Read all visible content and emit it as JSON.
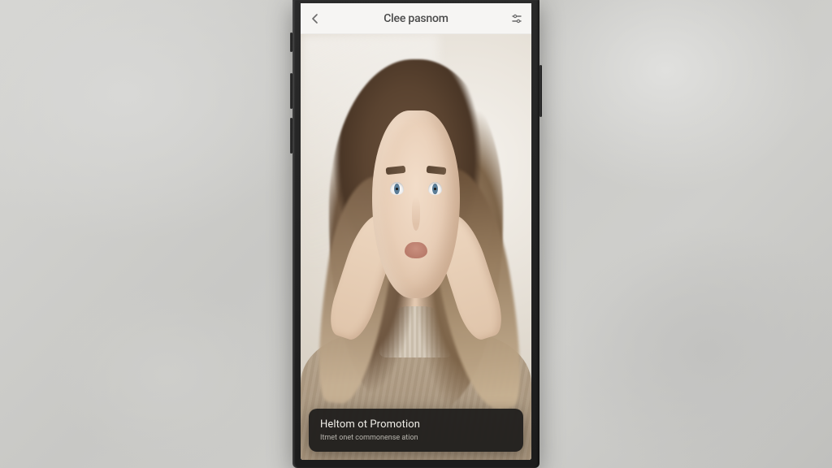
{
  "header": {
    "title": "Clee pasnom",
    "back_icon": "back-icon",
    "settings_icon": "sliders-icon"
  },
  "caption": {
    "title": "Heltom ot Promotion",
    "subtitle": "Itmet onet commonense ation"
  },
  "colors": {
    "screen_bg": "#f6f5f3",
    "card_bg": "rgba(20,20,20,0.88)",
    "card_text": "#f1efe9",
    "card_subtext": "#b9b6af"
  }
}
